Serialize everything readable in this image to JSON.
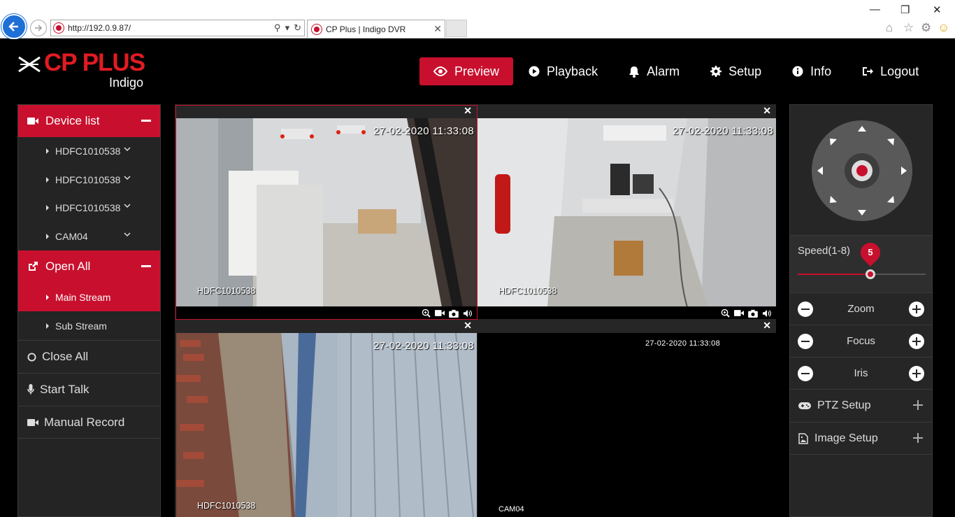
{
  "browser": {
    "url": "http://192.0.9.87/",
    "tab_title": "CP Plus | Indigo DVR"
  },
  "header": {
    "brand": "CP PLUS",
    "product": "Indigo",
    "nav": [
      {
        "label": "Preview",
        "icon": "eye-icon",
        "active": true
      },
      {
        "label": "Playback",
        "icon": "play-circle-icon"
      },
      {
        "label": "Alarm",
        "icon": "bell-icon"
      },
      {
        "label": "Setup",
        "icon": "gear-icon"
      },
      {
        "label": "Info",
        "icon": "info-icon"
      },
      {
        "label": "Logout",
        "icon": "logout-icon"
      }
    ]
  },
  "sidebar": {
    "device_list_label": "Device list",
    "devices": [
      "HDFC1010538",
      "HDFC1010538",
      "HDFC1010538",
      "CAM04"
    ],
    "open_all_label": "Open All",
    "streams": [
      {
        "label": "Main Stream",
        "active": true
      },
      {
        "label": "Sub Stream",
        "active": false
      }
    ],
    "close_all_label": "Close All",
    "start_talk_label": "Start Talk",
    "manual_record_label": "Manual Record"
  },
  "grid": {
    "cells": [
      {
        "timestamp": "27-02-2020 11:33:08",
        "channel": "HDFC1010538"
      },
      {
        "timestamp": "27-02-2020 11:33:08",
        "channel": "HDFC1010538"
      },
      {
        "timestamp": "27-02-2020 11:33:08",
        "channel": "HDFC1010538"
      },
      {
        "timestamp": "27-02-2020 11:33:08",
        "channel": "CAM04"
      }
    ]
  },
  "ptz": {
    "speed_label": "Speed(1-8)",
    "speed_value": "5",
    "speed_fraction": 0.57,
    "zoom_label": "Zoom",
    "focus_label": "Focus",
    "iris_label": "Iris",
    "ptz_setup_label": "PTZ Setup",
    "image_setup_label": "Image Setup"
  },
  "colors": {
    "accent": "#c8102e",
    "brand": "#e11b22"
  }
}
